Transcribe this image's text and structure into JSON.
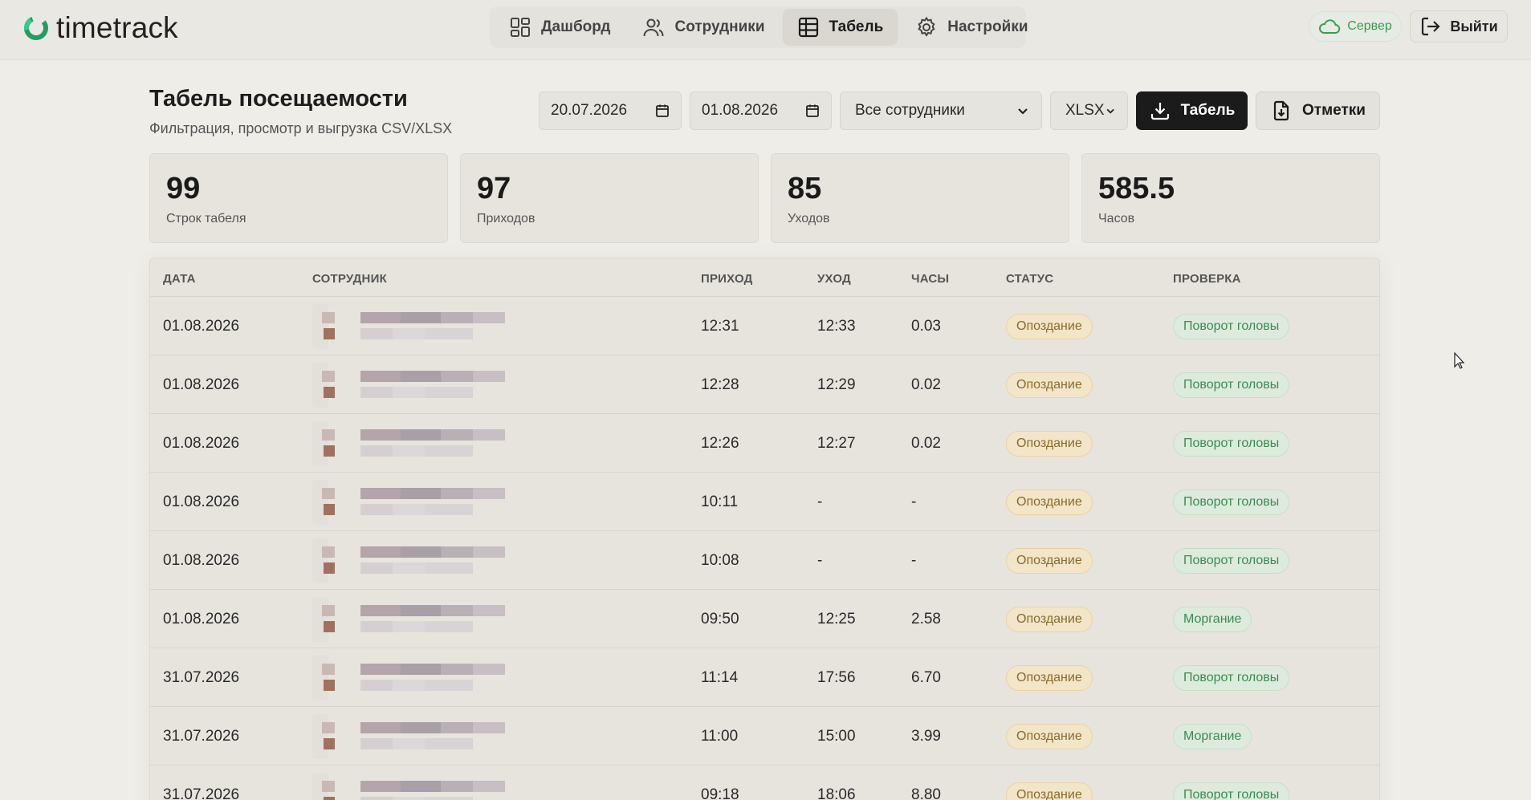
{
  "brand": {
    "name": "timetrack",
    "accent": "#2bb673"
  },
  "nav": [
    {
      "label": "Дашборд",
      "icon": "dashboard-grid-icon",
      "active": false
    },
    {
      "label": "Сотрудники",
      "icon": "users-icon",
      "active": false
    },
    {
      "label": "Табель",
      "icon": "table-icon",
      "active": true
    },
    {
      "label": "Настройки",
      "icon": "gear-icon",
      "active": false
    }
  ],
  "header": {
    "server_label": "Сервер",
    "logout_label": "Выйти"
  },
  "page": {
    "title": "Табель посещаемости",
    "subtitle": "Фильтрация, просмотр и выгрузка CSV/XLSX"
  },
  "filters": {
    "date_from": "20.07.2026",
    "date_to": "01.08.2026",
    "employee_select": "Все сотрудники",
    "format_select": "XLSX",
    "export_timesheet_label": "Табель",
    "export_marks_label": "Отметки"
  },
  "stats": [
    {
      "value": "99",
      "label": "Строк табеля"
    },
    {
      "value": "97",
      "label": "Приходов"
    },
    {
      "value": "85",
      "label": "Уходов"
    },
    {
      "value": "585.5",
      "label": "Часов"
    }
  ],
  "table": {
    "headers": {
      "date": "ДАТА",
      "employee": "СОТРУДНИК",
      "in": "ПРИХОД",
      "out": "УХОД",
      "hours": "ЧАСЫ",
      "status": "СТАТУС",
      "check": "ПРОВЕРКА"
    },
    "rows": [
      {
        "date": "01.08.2026",
        "in": "12:31",
        "out": "12:33",
        "hours": "0.03",
        "status": "Опоздание",
        "check": "Поворот головы"
      },
      {
        "date": "01.08.2026",
        "in": "12:28",
        "out": "12:29",
        "hours": "0.02",
        "status": "Опоздание",
        "check": "Поворот головы"
      },
      {
        "date": "01.08.2026",
        "in": "12:26",
        "out": "12:27",
        "hours": "0.02",
        "status": "Опоздание",
        "check": "Поворот головы"
      },
      {
        "date": "01.08.2026",
        "in": "10:11",
        "out": "-",
        "hours": "-",
        "status": "Опоздание",
        "check": "Поворот головы"
      },
      {
        "date": "01.08.2026",
        "in": "10:08",
        "out": "-",
        "hours": "-",
        "status": "Опоздание",
        "check": "Поворот головы"
      },
      {
        "date": "01.08.2026",
        "in": "09:50",
        "out": "12:25",
        "hours": "2.58",
        "status": "Опоздание",
        "check": "Моргание"
      },
      {
        "date": "31.07.2026",
        "in": "11:14",
        "out": "17:56",
        "hours": "6.70",
        "status": "Опоздание",
        "check": "Поворот головы"
      },
      {
        "date": "31.07.2026",
        "in": "11:00",
        "out": "15:00",
        "hours": "3.99",
        "status": "Опоздание",
        "check": "Моргание"
      },
      {
        "date": "31.07.2026",
        "in": "09:18",
        "out": "18:06",
        "hours": "8.80",
        "status": "Опоздание",
        "check": "Поворот головы"
      }
    ]
  }
}
